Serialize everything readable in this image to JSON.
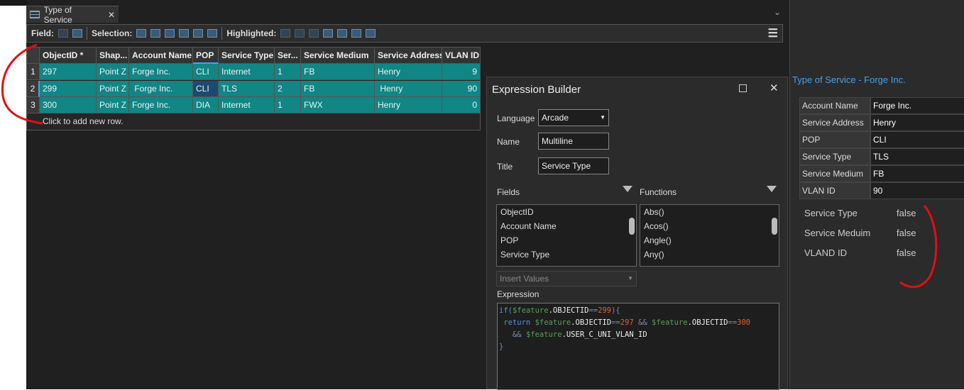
{
  "tab": {
    "title": "Type of Service",
    "icon": "table-icon"
  },
  "toolbar": {
    "field_label": "Field:",
    "selection_label": "Selection:",
    "highlighted_label": "Highlighted:"
  },
  "table": {
    "columns": [
      "ObjectID *",
      "Shap...",
      "Account Name",
      "POP",
      "Service Type",
      "Ser...",
      "Service Medium",
      "Service Address",
      "VLAN ID"
    ],
    "rows": [
      {
        "n": "1",
        "cells": [
          "297",
          "Point Z",
          "Forge Inc.",
          "CLI",
          "Internet",
          "1",
          "FB",
          "Henry",
          "9"
        ]
      },
      {
        "n": "2",
        "cells": [
          "299",
          "Point Z",
          " Forge Inc.",
          "CLI",
          "TLS",
          "2",
          "FB",
          " Henry",
          "90"
        ]
      },
      {
        "n": "3",
        "cells": [
          "300",
          "Point Z",
          "Forge Inc.",
          "DIA",
          "Internet",
          "1",
          "FWX",
          "Henry",
          "0"
        ]
      }
    ],
    "add_row": "Click to add new row."
  },
  "dialog": {
    "title": "Expression Builder",
    "language_label": "Language",
    "language": "Arcade",
    "name_label": "Name",
    "name": "Multiline",
    "title_label": "Title",
    "title_value": "Service Type",
    "fields_label": "Fields",
    "fields": [
      "ObjectID",
      "Account Name",
      "POP",
      "Service Type"
    ],
    "functions_label": "Functions",
    "functions": [
      "Abs()",
      "Acos()",
      "Angle()",
      "Any()"
    ],
    "insert_values": "Insert Values",
    "expression_label": "Expression",
    "expression_lines": [
      "if($feature.OBJECTID==299){",
      " return $feature.OBJECTID==297 && $feature.OBJECTID==300",
      "   && $feature.USER_C_UNI_VLAN_ID",
      "}"
    ]
  },
  "popup": {
    "title": "Type of Service -  Forge Inc.",
    "rows": [
      [
        "Account Name",
        "Forge Inc."
      ],
      [
        "Service Address",
        "Henry"
      ],
      [
        "POP",
        "CLI"
      ],
      [
        "Service Type",
        "TLS"
      ],
      [
        "Service Medium",
        "FB"
      ],
      [
        "VLAN ID",
        "90"
      ]
    ],
    "results": [
      [
        "Service Type",
        "false"
      ],
      [
        "Service Meduim",
        "false"
      ],
      [
        "VLAND ID",
        "false"
      ]
    ]
  },
  "colors": {
    "selected_row": "#128585",
    "annotation": "#e01010",
    "popup_title": "#4a9fe8"
  }
}
